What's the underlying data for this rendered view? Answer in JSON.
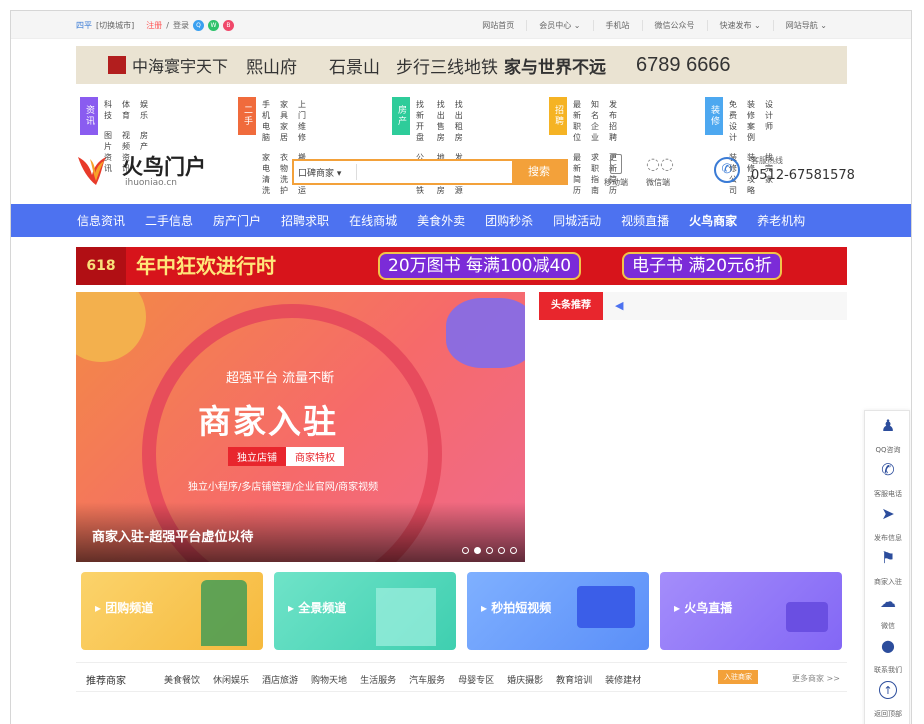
{
  "topbar": {
    "city": "四平",
    "switch_city": "[切换城市]",
    "register": "注册",
    "sep": "/",
    "login": "登录",
    "links": [
      "网站首页",
      "会员中心 ⌄",
      "手机站",
      "微信公众号",
      "快速发布 ⌄",
      "网站导航 ⌄"
    ]
  },
  "ad1": {
    "brand": "中海寰宇天下",
    "project": "熙山府",
    "location": "石景山",
    "slogan": "步行三线地铁",
    "slogan2": "家与世界不远",
    "phone": "6789 6666"
  },
  "catnav": [
    {
      "tag": "资讯",
      "color": "#8a5cf0",
      "items": [
        "科技",
        "体育",
        "娱乐",
        "图片资讯",
        "视频资讯",
        "房产"
      ]
    },
    {
      "tag": "二手",
      "color": "#f06b3c",
      "items": [
        "手机电脑",
        "家具家居",
        "上门维修",
        "家电清洗",
        "衣物洗护",
        "搬家速运"
      ]
    },
    {
      "tag": "房产",
      "color": "#2ecc9a",
      "items": [
        "找新开盘",
        "找出售房",
        "找出租房",
        "公交/地铁",
        "地图找房",
        "发布房源"
      ]
    },
    {
      "tag": "招聘",
      "color": "#f5b324",
      "items": [
        "最新职位",
        "知名企业",
        "发布招聘",
        "最新简历",
        "求职指南",
        "更新简历"
      ]
    },
    {
      "tag": "装修",
      "color": "#4da8f0",
      "items": [
        "免费设计",
        "装修案例",
        "设计师",
        "装修公司",
        "装修攻略",
        "找完家"
      ]
    }
  ],
  "logo": {
    "name": "火鸟门户",
    "domain": "ihuoniao.cn"
  },
  "search": {
    "scope": "口碑商家",
    "button": "搜索"
  },
  "qr": [
    {
      "label": "移动端"
    },
    {
      "label": "微信端"
    }
  ],
  "hotline": {
    "label": "客服热线",
    "number": "0512-67581578"
  },
  "mainnav": [
    "信息资讯",
    "二手信息",
    "房产门户",
    "招聘求职",
    "在线商城",
    "美食外卖",
    "团购秒杀",
    "同城活动",
    "视频直播",
    "火鸟商家",
    "养老机构"
  ],
  "ad2": {
    "tag": "618",
    "headline": "年中狂欢进行时",
    "deal1": "20万图书 每满100减40",
    "deal2": "电子书 满20元6折"
  },
  "banner": {
    "line1": "超强平台  流量不断",
    "title": "商家入驻",
    "tab1": "独立店铺",
    "tab2": "商家特权",
    "line3": "独立小程序/多店铺管理/企业官网/商家视频",
    "caption": "商家入驻-超强平台虚位以待"
  },
  "news": {
    "tag": "头条推荐"
  },
  "channels": [
    {
      "label": "团购频道",
      "color1": "#fbd36b",
      "color2": "#f6b93d"
    },
    {
      "label": "全景频道",
      "color1": "#6fe3c8",
      "color2": "#3fcfb0"
    },
    {
      "label": "秒拍短视频",
      "color1": "#7fb0ff",
      "color2": "#5b8ff8"
    },
    {
      "label": "火鸟直播",
      "color1": "#a48dfb",
      "color2": "#8367f5"
    }
  ],
  "rec": {
    "title": "推荐商家",
    "cats": [
      "美食餐饮",
      "休闲娱乐",
      "酒店旅游",
      "购物天地",
      "生活服务",
      "汽车服务",
      "母婴专区",
      "婚庆摄影",
      "教育培训",
      "装修建材"
    ],
    "join": "入驻商家",
    "more": "更多商家 >>"
  },
  "side": [
    "QQ咨询",
    "客服电话",
    "发布信息",
    "商家入驻",
    "微信",
    "联系我们",
    "返回顶部"
  ]
}
